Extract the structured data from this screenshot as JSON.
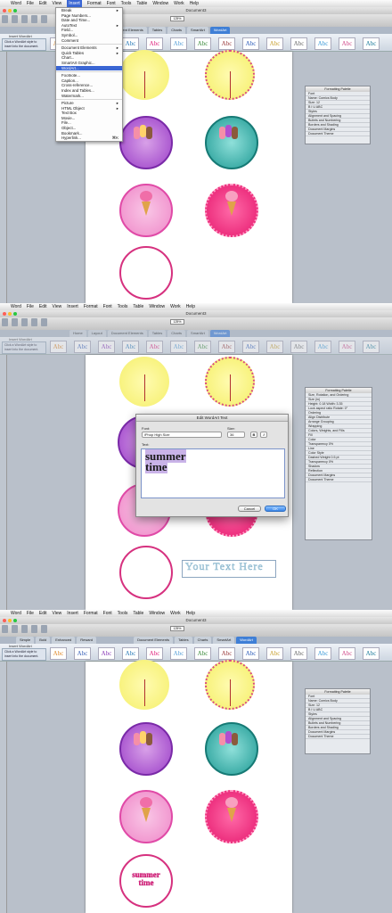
{
  "app": {
    "menubar": {
      "apple": "",
      "items": [
        "Word",
        "File",
        "Edit",
        "View",
        "Insert",
        "Format",
        "Font",
        "Tools",
        "Table",
        "Window",
        "Work",
        "Help"
      ],
      "active": "Insert"
    },
    "window_title": "Document3",
    "zoom": "125%",
    "ribbon_tabs": [
      "Home",
      "Layout",
      "Document Elements",
      "Tables",
      "Charts",
      "SmartArt",
      "WordArt"
    ],
    "ribbon_tabs_panel3": [
      "Simple",
      "Bold",
      "Enhanced",
      "Reward"
    ],
    "ribbon_group": "Insert WordArt",
    "insert_hint": "Click a WordArt style to insert into the document.",
    "wordart_sample": "Abc"
  },
  "insert_menu": {
    "items": [
      {
        "label": "Break",
        "arrow": true
      },
      {
        "label": "Page Numbers..."
      },
      {
        "label": "Date and Time..."
      },
      {
        "label": "AutoText",
        "arrow": true
      },
      {
        "label": "Field..."
      },
      {
        "label": "Symbol..."
      },
      {
        "label": "Comment"
      },
      {
        "sep": true
      },
      {
        "label": "Document Elements",
        "arrow": true
      },
      {
        "label": "Quick Tables",
        "arrow": true
      },
      {
        "label": "Chart..."
      },
      {
        "label": "SmartArt Graphic..."
      },
      {
        "label": "WordArt...",
        "highlight": true
      },
      {
        "sep": true
      },
      {
        "label": "Footnote..."
      },
      {
        "label": "Caption..."
      },
      {
        "label": "Cross-reference..."
      },
      {
        "label": "Index and Tables..."
      },
      {
        "label": "Watermark..."
      },
      {
        "sep": true
      },
      {
        "label": "Picture",
        "arrow": true
      },
      {
        "label": "HTML Object",
        "arrow": true
      },
      {
        "label": "Text Box"
      },
      {
        "label": "Movie..."
      },
      {
        "label": "File..."
      },
      {
        "label": "Object..."
      },
      {
        "label": "Bookmark..."
      },
      {
        "label": "Hyperlink...",
        "shortcut": "⌘K"
      }
    ]
  },
  "formatting_palette": {
    "title": "Formatting Palette",
    "rows": [
      "Font",
      "Name: Comics Body",
      "Size: 12",
      "B I U ABC",
      "Styles",
      "Alignment and Spacing",
      "Bullets and Numbering",
      "Borders and Shading",
      "Document Margins",
      "Document Theme"
    ]
  },
  "formatting_palette_2": {
    "title": "Formatting Palette",
    "rows": [
      "Size, Rotation, and Ordering",
      "Size (in)",
      "Height: 0.18   Width: 3.35",
      "Lock aspect ratio   Rotate: 0°",
      "Ordering",
      "Align   Distribute",
      "Arrange   Grouping",
      "Wrapping",
      "Colors, Weights, and Fills",
      "Fill",
      "Color",
      "Transparency 0%",
      "Line",
      "Color   Style",
      "Dashed   Weight 0.5 pt",
      "Transparency 0%",
      "Shadow",
      "Reflection",
      "Document Margins",
      "Document Theme"
    ]
  },
  "edit_dialog": {
    "title": "Edit WordArt Text",
    "font_label": "Font:",
    "font_value": "iPhop High Size",
    "size_label": "Size:",
    "size_value": "36",
    "bold": "B",
    "italic": "I",
    "text_label": "Text:",
    "text_line1": "summer",
    "text_line2": "time",
    "cancel": "Cancel",
    "ok": "OK"
  },
  "doc": {
    "placeholder_wordart": "Your Text Here",
    "final_line1": "summer",
    "final_line2": "time"
  },
  "colors": {
    "accent": "#3a66d4",
    "pink": "#e0217c",
    "yellow": "#f5ef6a",
    "teal": "#1f9a94",
    "purple": "#9b3fc8"
  }
}
